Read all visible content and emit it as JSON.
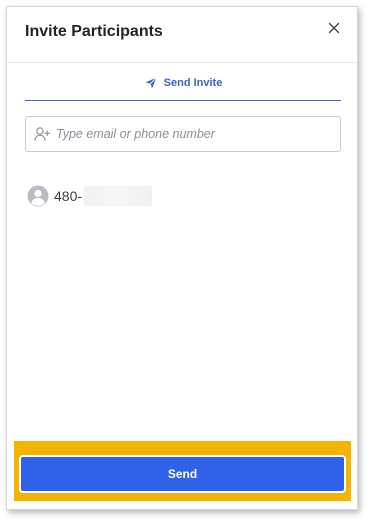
{
  "dialog": {
    "title": "Invite Participants",
    "close_icon": "close-icon"
  },
  "tabs": [
    {
      "label": "Send Invite",
      "icon": "send-icon",
      "active": true
    }
  ],
  "search": {
    "placeholder": "Type email or phone number",
    "value": "",
    "icon": "add-user-icon"
  },
  "participants": [
    {
      "phone_prefix": "480-",
      "avatar": "user-avatar-icon"
    }
  ],
  "footer": {
    "send_label": "Send"
  },
  "colors": {
    "accent": "#2f62e8",
    "tab_accent": "#3a63c7",
    "highlight": "#f4b400"
  }
}
